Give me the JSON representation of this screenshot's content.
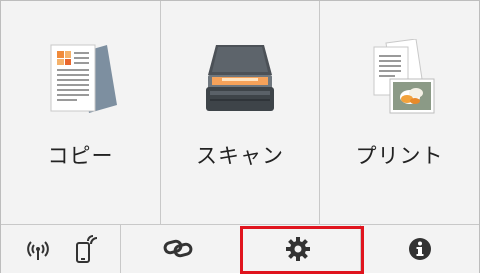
{
  "tiles": [
    {
      "label": "コピー",
      "icon": "copy-document-icon"
    },
    {
      "label": "スキャン",
      "icon": "scanner-icon"
    },
    {
      "label": "プリント",
      "icon": "print-photo-icon"
    }
  ],
  "bottom_bar": [
    {
      "icon": "wireless-direct-icon"
    },
    {
      "icon": "mobile-connect-icon"
    },
    {
      "icon": "link-icon"
    },
    {
      "icon": "gear-icon"
    },
    {
      "icon": "info-icon"
    }
  ],
  "highlight_color": "#e0141e"
}
